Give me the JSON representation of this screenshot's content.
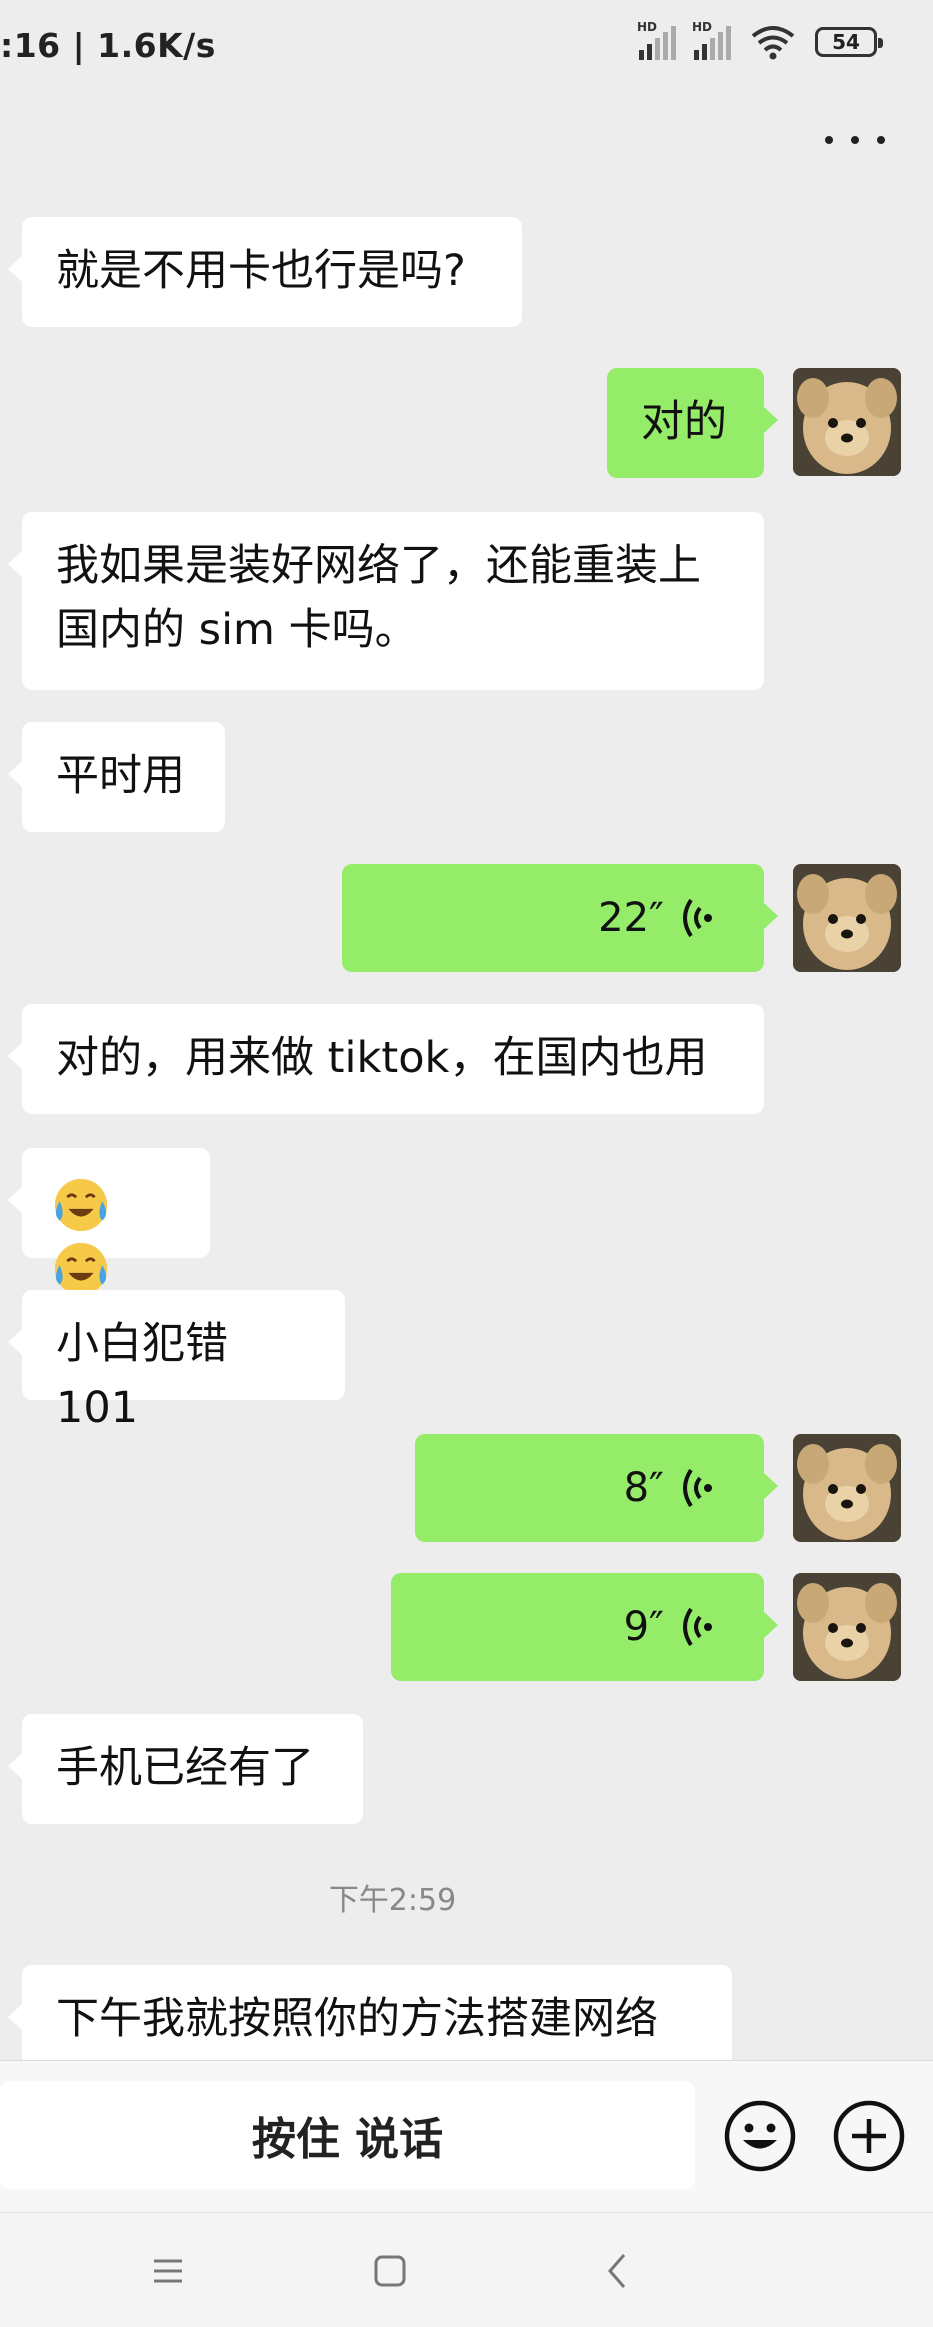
{
  "status": {
    "time": ":16 | 1.6K/s",
    "sim1": "HD",
    "sim2": "HD",
    "battery": "54"
  },
  "messages": [
    {
      "side": "in",
      "text": "就是不用卡也行是吗?"
    },
    {
      "side": "out",
      "text": "对的"
    },
    {
      "side": "in",
      "line1": "我如果是装好网络了，还能重装上",
      "line2": "国内的 sim 卡吗。"
    },
    {
      "side": "in",
      "text": "平时用"
    },
    {
      "side": "out",
      "type": "voice",
      "duration": "22″"
    },
    {
      "side": "in",
      "text": "对的，用来做 tiktok，在国内也用"
    },
    {
      "side": "in",
      "type": "emoji",
      "emoji": [
        "face-tears-icon",
        "face-tears-icon"
      ]
    },
    {
      "side": "in",
      "text": "小白犯错 101"
    },
    {
      "side": "out",
      "type": "voice",
      "duration": "8″"
    },
    {
      "side": "out",
      "type": "voice",
      "duration": "9″"
    },
    {
      "side": "in",
      "text": "手机已经有了"
    },
    {
      "side": "in",
      "text": "下午我就按照你的方法搭建网络"
    }
  ],
  "timestamp": "下午2:59",
  "input": {
    "hold_to_talk": "按住 说话"
  },
  "colors": {
    "background": "#ededed",
    "outgoing_bubble": "#95ec69",
    "incoming_bubble": "#ffffff"
  }
}
